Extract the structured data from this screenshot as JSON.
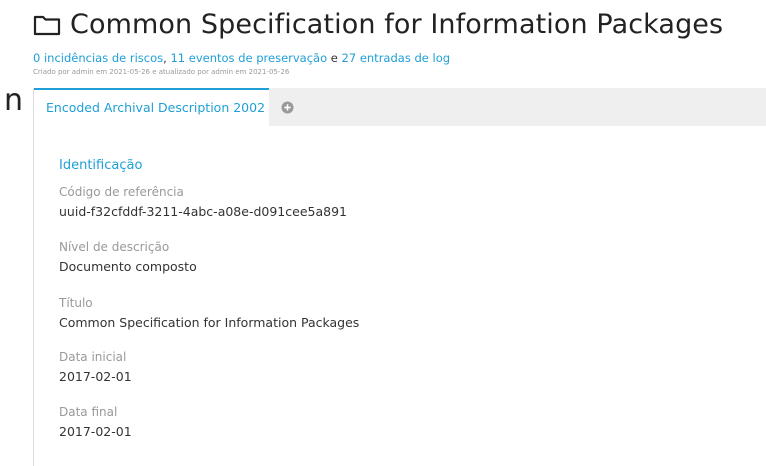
{
  "edge_letter": "n",
  "header": {
    "icon": "folder-icon",
    "title": "Common Specification for Information Packages",
    "risk_link": "0 incidências de riscos",
    "separator1": ",",
    "preservation_link": "11 eventos de preservação",
    "conjunction": "e",
    "log_link": "27 entradas de log",
    "created": "Criado por admin em 2021-05-26 e atualizado por admin em 2021-05-26"
  },
  "tabs": {
    "active_label": "Encoded Archival Description 2002",
    "add_icon": "plus-circle-icon"
  },
  "section": {
    "title": "Identificação",
    "fields": [
      {
        "label": "Código de referência",
        "value": "uuid-f32cfddf-3211-4abc-a08e-d091cee5a891"
      },
      {
        "label": "Nível de descrição",
        "value": "Documento composto"
      },
      {
        "label": "Título",
        "value": "Common Specification for Information Packages"
      },
      {
        "label": "Data inicial",
        "value": "2017-02-01"
      },
      {
        "label": "Data final",
        "value": "2017-02-01"
      }
    ]
  },
  "colors": {
    "accent": "#1f9fd6",
    "tabs_bg": "#efefef",
    "label": "#999999",
    "text": "#333333"
  }
}
